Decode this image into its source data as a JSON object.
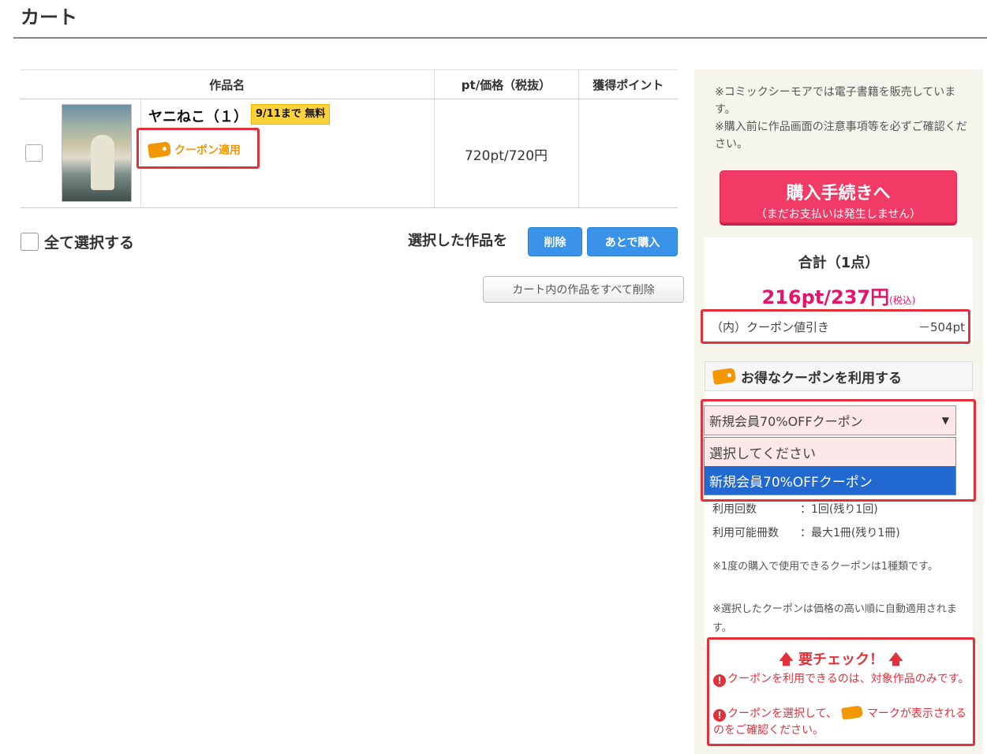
{
  "page": {
    "title": "カート"
  },
  "table": {
    "headers": {
      "name": "作品名",
      "price": "pt/価格（税抜）",
      "points": "獲得ポイント"
    },
    "rows": [
      {
        "title": "ヤニねこ（１）",
        "badge": "9/11まで 無料",
        "coupon_tag": "クーポン適用",
        "price": "720pt/720円",
        "points": ""
      }
    ]
  },
  "actions": {
    "select_all": "全て選択する",
    "selected_label": "選択した作品を",
    "delete": "削除",
    "buy_later": "あとで購入",
    "delete_all": "カート内の作品をすべて削除"
  },
  "sidebar": {
    "notice": "※コミックシーモアでは電子書籍を販売しています。\n※購入前に作品画面の注意事項等を必ずご確認ください。",
    "buy_button": {
      "label": "購入手続きへ",
      "sublabel": "（まだお支払いは発生しません）"
    },
    "total": {
      "heading": "合計（1点）",
      "price": "216pt/237円",
      "tax": "(税込)",
      "discount_label": "（内）クーポン値引き",
      "discount_value": "－504pt"
    },
    "coupon": {
      "heading": "お得なクーポンを利用する",
      "selected": "新規会員70%OFFクーポン",
      "options": [
        "選択してください",
        "新規会員70%OFFクーポン"
      ],
      "usage_count_label": "利用回数",
      "usage_count_value": "：1回(残り1回)",
      "usage_books_label": "利用可能冊数",
      "usage_books_value": "：最大1冊(残り1冊)",
      "note1": "※1度の購入で使用できるクーポンは1種類です。",
      "note2": "※選択したクーポンは価格の高い順に自動適用されます。"
    },
    "check": {
      "title": "要チェック！",
      "line1": "クーポンを利用できるのは、対象作品のみです。",
      "line2a": "クーポンを選択して、",
      "line2b": "マークが表示されるのをご確認ください。"
    }
  },
  "colors": {
    "accent_red": "#e3303b",
    "buy_button": "#f23a66",
    "price_pink": "#e6136b",
    "button_blue": "#3a93e8",
    "coupon_orange": "#f39700",
    "badge_yellow": "#ffd23a"
  }
}
